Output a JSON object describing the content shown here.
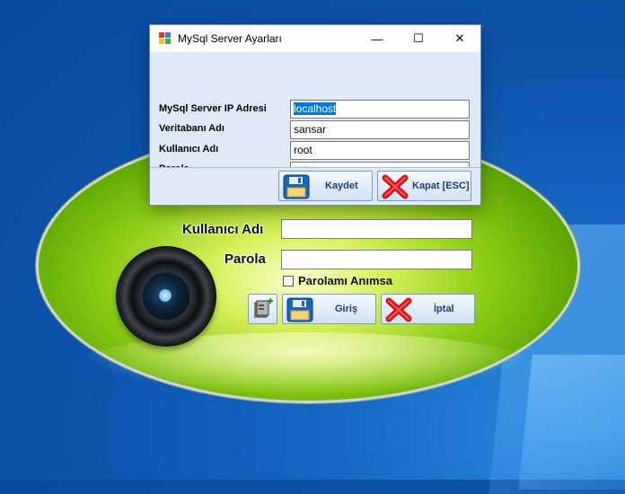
{
  "dialog": {
    "title": "MySql Server Ayarları",
    "labels": {
      "server_ip": "MySql Server IP Adresi",
      "database": "Veritabanı Adı",
      "username": "Kullanıcı Adı",
      "password": "Parola"
    },
    "values": {
      "server_ip": "localhost",
      "database": "sansar",
      "username": "root",
      "password": "*****"
    },
    "buttons": {
      "save": "Kaydet",
      "close": "Kapat [ESC]"
    },
    "titlebar_buttons": {
      "minimize": "—",
      "maximize": "☐",
      "close": "✕"
    }
  },
  "login": {
    "username_label": "Kullanıcı Adı",
    "password_label": "Parola",
    "username_value": "",
    "password_value": "",
    "remember_label": "Parolamı Anımsa",
    "remember_checked": false,
    "buttons": {
      "login": "Giriş",
      "cancel": "İptal"
    }
  },
  "colors": {
    "desktop": "#0d54ad",
    "splash_green": "#8bcc15",
    "dialog_panel": "#dfe9f7",
    "selection": "#0078d7",
    "cancel_red": "#d8141a"
  }
}
